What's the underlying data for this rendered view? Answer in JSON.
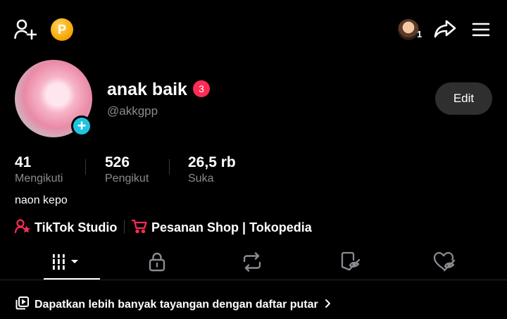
{
  "profile": {
    "display_name": "anak baik",
    "notification_count": "3",
    "username": "@akkgpp",
    "edit_label": "Edit",
    "bio": "naon kepo"
  },
  "top_bar": {
    "coin_letter": "P",
    "friend_count": "1"
  },
  "stats": [
    {
      "value": "41",
      "label": "Mengikuti"
    },
    {
      "value": "526",
      "label": "Pengikut"
    },
    {
      "value": "26,5 rb",
      "label": "Suka"
    }
  ],
  "links": {
    "studio": "TikTok Studio",
    "shop": "Pesanan Shop | Tokopedia"
  },
  "tabs": [
    "videos-grid-icon",
    "lock-icon",
    "repost-icon",
    "favorites-icon",
    "liked-icon"
  ],
  "playlist_banner": "Dapatkan lebih banyak tayangan dengan daftar putar",
  "colors": {
    "accent_red": "#fe2c55",
    "add_badge_cyan": "#20c4e0",
    "coin_gold": "#f5a300",
    "muted_text": "#8a8b91"
  }
}
